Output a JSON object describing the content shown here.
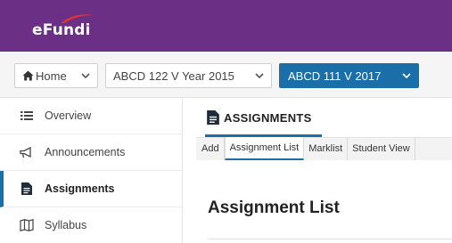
{
  "header": {
    "logo_text": "eFundi",
    "brand_color": "#6c2f86"
  },
  "breadcrumbs": {
    "home_label": "Home",
    "site1_label": "ABCD 122 V Year 2015",
    "site2_label": "ABCD 111 V 2017",
    "active_color": "#1b6fa8"
  },
  "sidebar": {
    "items": [
      {
        "label": "Overview",
        "icon": "list-icon",
        "active": false
      },
      {
        "label": "Announcements",
        "icon": "megaphone-icon",
        "active": false
      },
      {
        "label": "Assignments",
        "icon": "document-icon",
        "active": true
      },
      {
        "label": "Syllabus",
        "icon": "map-icon",
        "active": false
      }
    ]
  },
  "tool": {
    "title": "ASSIGNMENTS",
    "tabs": [
      {
        "label": "Add"
      },
      {
        "label": "Assignment List",
        "active": true
      },
      {
        "label": "Marklist"
      },
      {
        "label": "Student View"
      }
    ],
    "page_title": "Assignment List"
  }
}
